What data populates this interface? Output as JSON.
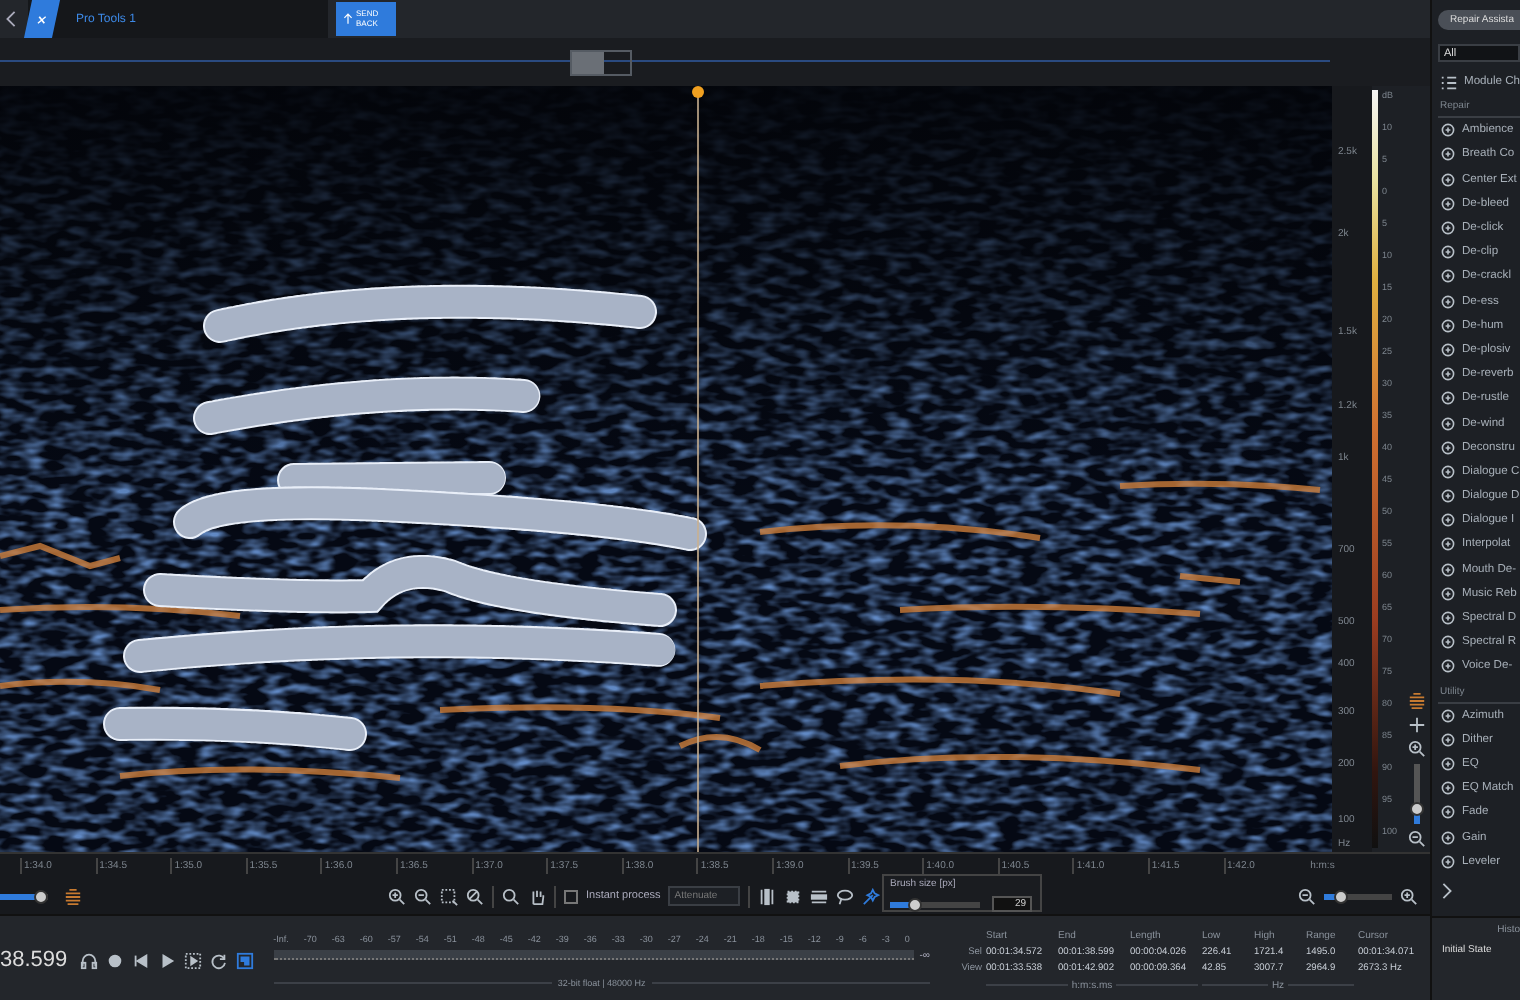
{
  "tab": {
    "title": "Pro Tools 1"
  },
  "send_back": {
    "label": "SEND BACK"
  },
  "repair_assistant": {
    "label": "Repair Assista"
  },
  "freq_axis": {
    "labels": [
      "2.5k",
      "2k",
      "1.5k",
      "1.2k",
      "1k",
      "700",
      "500",
      "400",
      "300",
      "200",
      "100",
      "Hz"
    ]
  },
  "level_scale": {
    "labels": [
      "dB",
      "10",
      "5",
      "0",
      "5",
      "10",
      "15",
      "20",
      "25",
      "30",
      "35",
      "40",
      "45",
      "50",
      "55",
      "60",
      "65",
      "70",
      "75",
      "80",
      "85",
      "90",
      "95",
      "100"
    ]
  },
  "vertical_zoom": {
    "level": 0.25
  },
  "time_axis": {
    "ticks": [
      "1:34.0",
      "1:34.5",
      "1:35.0",
      "1:35.5",
      "1:36.0",
      "1:36.5",
      "1:37.0",
      "1:37.5",
      "1:38.0",
      "1:38.5",
      "1:39.0",
      "1:39.5",
      "1:40.0",
      "1:40.5",
      "1:41.0",
      "1:41.5",
      "1:42.0"
    ],
    "unit": "h:m:s"
  },
  "toolbar": {
    "scroll_slider": {
      "level": 0.85
    },
    "instant_process": {
      "label": "Instant process",
      "checked": false
    },
    "mode": {
      "value": "Attenuate"
    },
    "selection_tools": [
      {
        "kind": "time",
        "selected": false
      },
      {
        "kind": "time_frequency",
        "selected": false
      },
      {
        "kind": "frequency",
        "selected": false
      },
      {
        "kind": "lasso",
        "selected": false
      },
      {
        "kind": "brush",
        "selected": true
      }
    ],
    "brush_size": {
      "label": "Brush size [px]",
      "level": 0.28,
      "value": "29"
    },
    "horizontal_zoom": {
      "level": 0.25
    }
  },
  "transport": {
    "time": "38.599",
    "buttons": [
      {
        "kind": "headphones",
        "on": false
      },
      {
        "kind": "record",
        "on": false
      },
      {
        "kind": "previous",
        "on": false
      },
      {
        "kind": "play",
        "on": false
      },
      {
        "kind": "play_selection",
        "on": false
      },
      {
        "kind": "loop",
        "on": false
      },
      {
        "kind": "follow",
        "on": true
      }
    ]
  },
  "meter": {
    "scale": [
      "-Inf.",
      "-70",
      "-63",
      "-60",
      "-57",
      "-54",
      "-51",
      "-48",
      "-45",
      "-42",
      "-39",
      "-36",
      "-33",
      "-30",
      "-27",
      "-24",
      "-21",
      "-18",
      "-15",
      "-12",
      "-9",
      "-6",
      "-3",
      "0"
    ],
    "end_label": "-∞",
    "format": "32-bit float | 48000 Hz"
  },
  "info": {
    "headers": [
      "Start",
      "End",
      "Length",
      "Low",
      "High",
      "Range",
      "Cursor"
    ],
    "rows": [
      {
        "label": "Sel",
        "values": [
          "00:01:34.572",
          "00:01:38.599",
          "00:00:04.026",
          "226.41",
          "1721.4",
          "1495.0",
          "00:01:34.071"
        ]
      },
      {
        "label": "View",
        "values": [
          "00:01:33.538",
          "00:01:42.902",
          "00:00:09.364",
          "42.85",
          "3007.7",
          "2964.9",
          "2673.3 Hz"
        ]
      }
    ],
    "time_unit": "h:m:s.ms",
    "freq_unit": "Hz"
  },
  "history": {
    "title": "Histo",
    "items": [
      "Initial State"
    ]
  },
  "modules": {
    "filter": "All",
    "chain": "Module Ch",
    "sections": [
      {
        "title": "Repair",
        "items": [
          "Ambience",
          "Breath Co",
          "Center Ext",
          "De-bleed",
          "De-click",
          "De-clip",
          "De-crackl",
          "De-ess",
          "De-hum",
          "De-plosiv",
          "De-reverb",
          "De-rustle",
          "De-wind",
          "Deconstru",
          "Dialogue C",
          "Dialogue D",
          "Dialogue I",
          "Interpolat",
          "Mouth De-",
          "Music Reb",
          "Spectral D",
          "Spectral R",
          "Voice De-"
        ]
      },
      {
        "title": "Utility",
        "items": [
          "Azimuth",
          "Dither",
          "EQ",
          "EQ Match",
          "Fade",
          "Gain",
          "Leveler"
        ]
      }
    ]
  }
}
